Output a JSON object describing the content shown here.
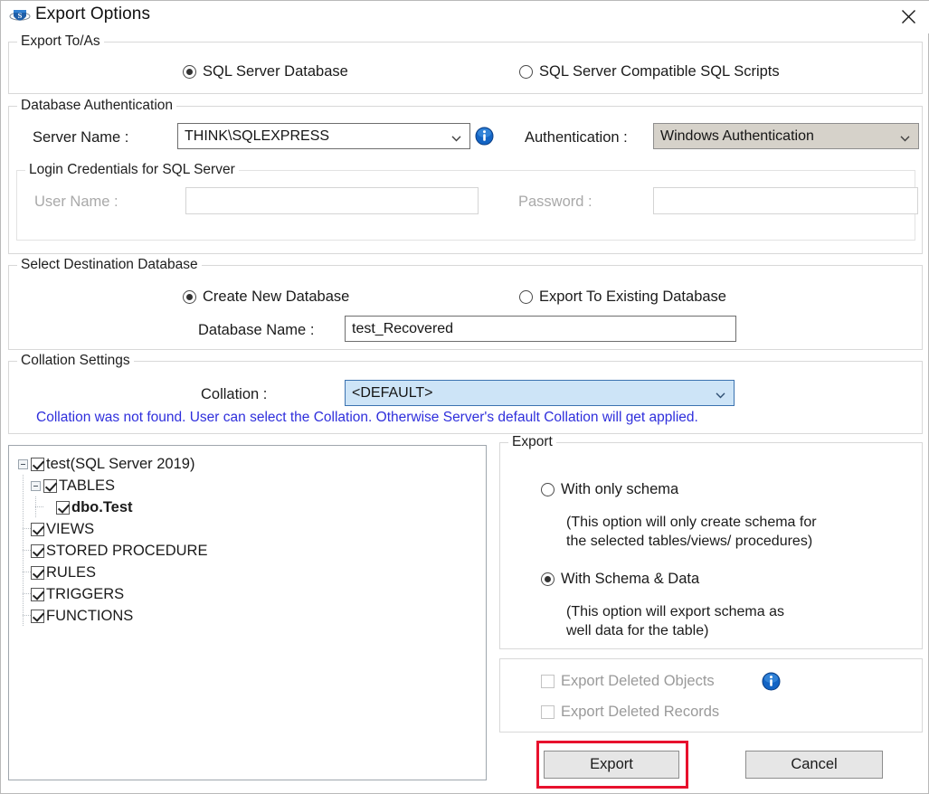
{
  "window": {
    "title": "Export Options",
    "app_icon": "shield-s-logo-icon",
    "close_icon": "close-icon"
  },
  "export_to_as": {
    "legend": "Export To/As",
    "options": [
      {
        "label": "SQL Server Database",
        "selected": true
      },
      {
        "label": "SQL Server Compatible SQL Scripts",
        "selected": false
      }
    ]
  },
  "database_authentication": {
    "legend": "Database Authentication",
    "server_name_label": "Server Name :",
    "server_name_value": "THINK\\SQLEXPRESS",
    "info_icon": "info-icon",
    "authentication_label": "Authentication :",
    "authentication_value": "Windows Authentication",
    "login_credentials": {
      "legend": "Login Credentials for SQL Server",
      "user_name_label": "User Name :",
      "user_name_value": "",
      "password_label": "Password :",
      "password_value": ""
    }
  },
  "destination_database": {
    "legend": "Select Destination Database",
    "options": [
      {
        "label": "Create New Database",
        "selected": true
      },
      {
        "label": "Export To Existing Database",
        "selected": false
      }
    ],
    "database_name_label": "Database Name :",
    "database_name_value": "test_Recovered"
  },
  "collation_settings": {
    "legend": "Collation Settings",
    "collation_label": "Collation :",
    "collation_value": "<DEFAULT>",
    "note": "Collation was not found. User can select the Collation. Otherwise Server's default Collation will get applied.",
    "note_color": "#2f2fdc",
    "combo_fill": "#cde4f7"
  },
  "object_tree": {
    "nodes": [
      {
        "label": "test(SQL Server 2019)",
        "level": 0,
        "checked": true,
        "expanded": true,
        "bold": false
      },
      {
        "label": "TABLES",
        "level": 1,
        "checked": true,
        "expanded": true,
        "bold": false
      },
      {
        "label": "dbo.Test",
        "level": 2,
        "checked": true,
        "expanded": null,
        "bold": true
      },
      {
        "label": "VIEWS",
        "level": 1,
        "checked": true,
        "expanded": null,
        "bold": false
      },
      {
        "label": "STORED PROCEDURE",
        "level": 1,
        "checked": true,
        "expanded": null,
        "bold": false
      },
      {
        "label": "RULES",
        "level": 1,
        "checked": true,
        "expanded": null,
        "bold": false
      },
      {
        "label": "TRIGGERS",
        "level": 1,
        "checked": true,
        "expanded": null,
        "bold": false
      },
      {
        "label": "FUNCTIONS",
        "level": 1,
        "checked": true,
        "expanded": null,
        "bold": false
      }
    ]
  },
  "export_group": {
    "legend": "Export",
    "schema_only": {
      "label": "With only schema",
      "selected": false,
      "description": "(This option will only create schema for\nthe  selected tables/views/ procedures)"
    },
    "schema_and_data": {
      "label": "With Schema & Data",
      "selected": true,
      "description": "(This option will export schema as\nwell data for the table)"
    }
  },
  "deleted_group": {
    "export_deleted_objects": {
      "label": "Export Deleted Objects",
      "checked": false,
      "disabled": true
    },
    "export_deleted_records": {
      "label": "Export Deleted Records",
      "checked": false,
      "disabled": true
    },
    "info_icon": "info-icon"
  },
  "actions": {
    "export_label": "Export",
    "cancel_label": "Cancel",
    "focus_highlight_color": "#e8112d"
  }
}
